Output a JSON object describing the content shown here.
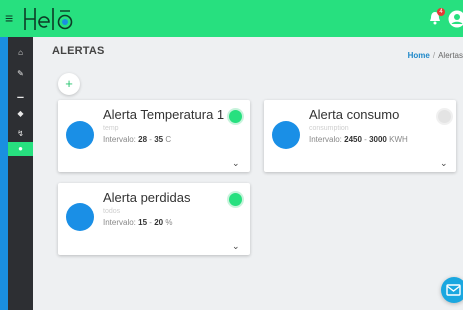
{
  "header": {
    "notifications_count": "4"
  },
  "sidebar": {
    "items": [
      {
        "icon": "home-icon",
        "glyph": "⌂"
      },
      {
        "icon": "wrench-icon",
        "glyph": "✎"
      },
      {
        "icon": "chart-icon",
        "glyph": "▁"
      },
      {
        "icon": "tag-icon",
        "glyph": "◆"
      },
      {
        "icon": "plug-icon",
        "glyph": "↯"
      },
      {
        "icon": "bell-icon",
        "glyph": "●"
      }
    ],
    "active_index": 5
  },
  "page": {
    "title": "ALERTAS",
    "breadcrumb": {
      "home": "Home",
      "separator": "/",
      "current": "Alertas"
    },
    "add_label": "+"
  },
  "alerts": [
    {
      "title": "Alerta Temperatura 1",
      "subtitle": "temp",
      "interval_label": "Intervalo:",
      "min": "28",
      "sep": "-",
      "max": "35",
      "unit": "C",
      "active": true
    },
    {
      "title": "Alerta consumo",
      "subtitle": "consumption",
      "interval_label": "Intervalo:",
      "min": "2450",
      "sep": "-",
      "max": "3000",
      "unit": "KWH",
      "active": false
    },
    {
      "title": "Alerta perdidas",
      "subtitle": "todos",
      "interval_label": "Intervalo:",
      "min": "15",
      "sep": "-",
      "max": "20",
      "unit": "%",
      "active": true
    }
  ],
  "colors": {
    "accent": "#27e07f",
    "circle": "#1a8fe6",
    "sidebar": "#2d2f33"
  }
}
